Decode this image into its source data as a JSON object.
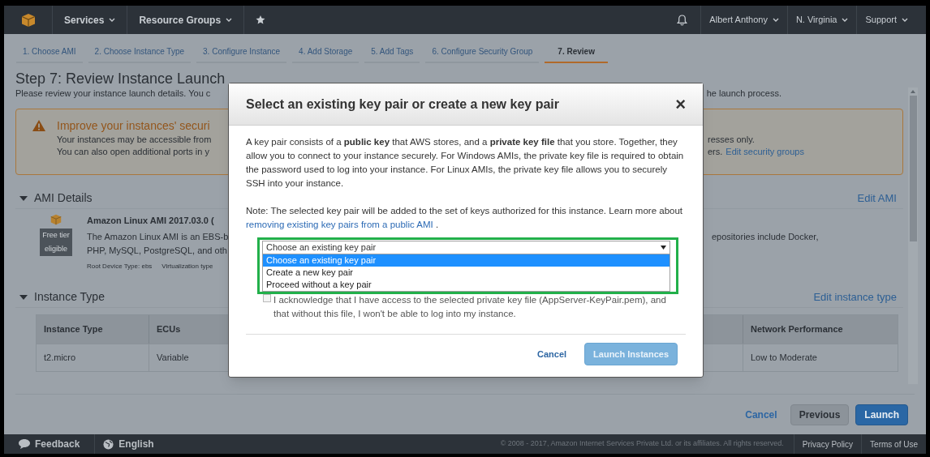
{
  "nav": {
    "menus": [
      {
        "label": "Services",
        "dropdown": true
      },
      {
        "label": "Resource Groups",
        "dropdown": true
      }
    ],
    "right": [
      {
        "label": "Albert Anthony",
        "dropdown": true
      },
      {
        "label": "N. Virginia",
        "dropdown": true
      },
      {
        "label": "Support",
        "dropdown": true
      }
    ]
  },
  "wizard_tabs": [
    {
      "label": "1. Choose AMI",
      "selected": false
    },
    {
      "label": "2. Choose Instance Type",
      "selected": false
    },
    {
      "label": "3. Configure Instance",
      "selected": false
    },
    {
      "label": "4. Add Storage",
      "selected": false
    },
    {
      "label": "5. Add Tags",
      "selected": false
    },
    {
      "label": "6. Configure Security Group",
      "selected": false
    },
    {
      "label": "7. Review",
      "selected": true
    }
  ],
  "page": {
    "title": "Step 7: Review Instance Launch",
    "subtitle_left": "Please review your instance launch details. You c",
    "subtitle_right": "he launch process.",
    "alert": {
      "title": "Improve your instances' securi",
      "line1_left": "Your instances may be accessible from",
      "line1_right": "resses only.",
      "line2_left": "You can also open additional ports in y",
      "line2_right": "ers.",
      "link": "Edit security groups"
    },
    "ami_section": {
      "title": "AMI Details",
      "expanded": true,
      "edit_link": "Edit AMI",
      "name": "Amazon Linux AMI 2017.03.0 (",
      "badge": "Free tier eligible",
      "desc_left_1": "The Amazon Linux AMI is an EBS-b",
      "desc_right_1": "epositories include Docker,",
      "desc_left_2": "PHP, MySQL, PostgreSQL, and oth",
      "meta": [
        "Root Device Type: ebs",
        "Virtualization type"
      ]
    },
    "instance_section": {
      "title": "Instance Type",
      "expanded": true,
      "edit_link": "Edit instance type",
      "table": {
        "columns": [
          "Instance Type",
          "ECUs",
          "Network Performance"
        ],
        "rows": [
          [
            "t2.micro",
            "Variable",
            "Low to Moderate"
          ]
        ]
      }
    },
    "actions": [
      {
        "label": "Cancel",
        "kind": "link"
      },
      {
        "label": "Previous",
        "kind": "secondary"
      },
      {
        "label": "Launch",
        "kind": "primary"
      }
    ]
  },
  "modal": {
    "title": "Select an existing key pair or create a new key pair",
    "close": "×",
    "paragraph": "A key pair consists of a **public key** that AWS stores, and a **private key file** that you store. Together, they allow you to connect to your instance securely. For Windows AMIs, the private key file is required to obtain the password used to log into your instance. For Linux AMIs, the private key file allows you to securely SSH into your instance.",
    "note": "Note: The selected key pair will be added to the set of keys authorized for this instance. Learn more about ",
    "note_link": "removing existing key pairs from a public AMI",
    "note_end": " .",
    "select": {
      "value": "Choose an existing key pair",
      "expanded": true,
      "options": [
        {
          "label": "Choose an existing key pair",
          "selected": true
        },
        {
          "label": "Create a new key pair",
          "selected": false
        },
        {
          "label": "Proceed without a key pair",
          "selected": false
        }
      ]
    },
    "acknowledge": {
      "text": "I acknowledge that I have access to the selected private key file (AppServer-KeyPair.pem), and that without this file, I won't be able to log into my instance.",
      "checked": false
    },
    "buttons": [
      {
        "label": "Cancel",
        "kind": "link",
        "disabled": false
      },
      {
        "label": "Launch Instances",
        "kind": "primary",
        "disabled": true
      }
    ]
  },
  "footer": {
    "feedback": "Feedback",
    "language": "English",
    "copyright": "© 2008 - 2017, Amazon Internet Services Private Ltd. or its affiliates. All rights reserved.",
    "links": [
      "Privacy Policy",
      "Terms of Use"
    ]
  }
}
